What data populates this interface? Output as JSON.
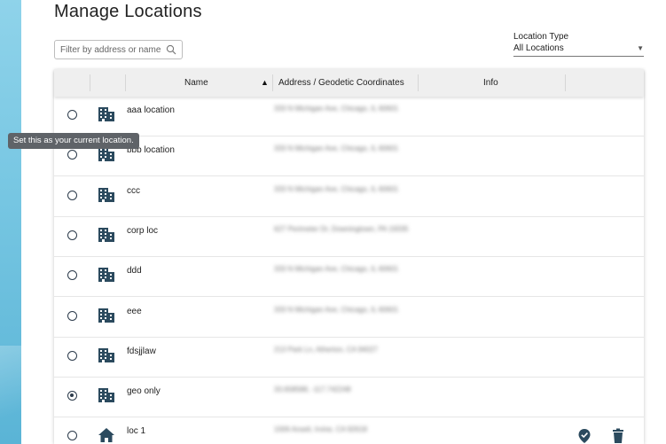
{
  "page": {
    "title": "Manage Locations"
  },
  "filter": {
    "placeholder": "Filter by address or name",
    "value": ""
  },
  "location_type": {
    "label": "Location Type",
    "selected": "All Locations"
  },
  "table": {
    "columns": {
      "name": "Name",
      "address": "Address / Geodetic Coordinates",
      "info": "Info"
    },
    "sort": {
      "column": "Name",
      "direction": "ascending"
    },
    "rows": [
      {
        "name": "aaa location",
        "address": "333 N Michigan Ave, Chicago, IL 60601",
        "icon": "building-icon",
        "selected": false
      },
      {
        "name": "bbb location",
        "address": "333 N Michigan Ave, Chicago, IL 60601",
        "icon": "building-icon",
        "selected": false
      },
      {
        "name": "ccc",
        "address": "333 N Michigan Ave, Chicago, IL 60601",
        "icon": "building-icon",
        "selected": false
      },
      {
        "name": "corp loc",
        "address": "627 Perimeter Dr, Downingtown, PA 19335",
        "icon": "building-icon",
        "selected": false
      },
      {
        "name": "ddd",
        "address": "333 N Michigan Ave, Chicago, IL 60601",
        "icon": "building-icon",
        "selected": false
      },
      {
        "name": "eee",
        "address": "333 N Michigan Ave, Chicago, IL 60601",
        "icon": "building-icon",
        "selected": false
      },
      {
        "name": "fdsjjlaw",
        "address": "213 Park Ln, Atherton, CA 94027",
        "icon": "building-icon",
        "selected": false
      },
      {
        "name": "geo only",
        "address": "33.658588, -117.742248",
        "icon": "building-icon",
        "selected": true
      },
      {
        "name": "loc 1",
        "address": "1006 Anseli, Irvine, CA 92618",
        "icon": "home-icon",
        "selected": false,
        "actions": [
          "verified-location-icon",
          "delete-icon"
        ]
      }
    ]
  },
  "tooltip": {
    "text": "Set this as your current location."
  },
  "colors": {
    "accent": "#2b4a5e",
    "side_band": "#7fcbe5",
    "header_bg": "#efefef"
  }
}
